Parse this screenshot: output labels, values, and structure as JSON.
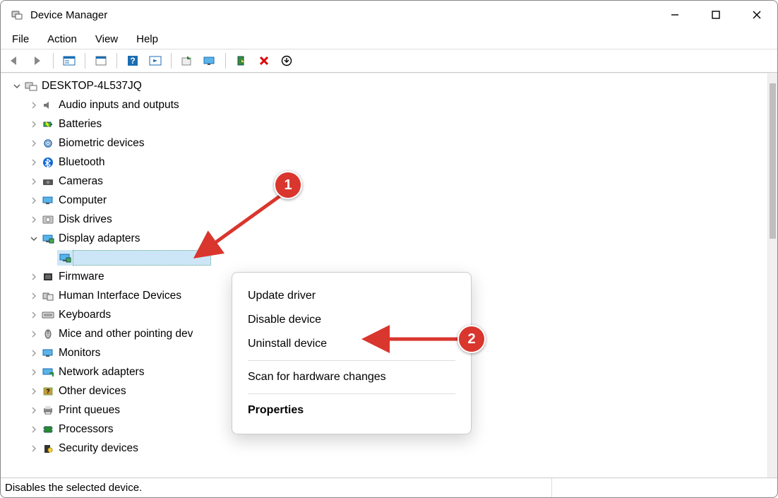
{
  "title": "Device Manager",
  "menubar": [
    "File",
    "Action",
    "View",
    "Help"
  ],
  "root_node": "DESKTOP-4L537JQ",
  "categories": [
    {
      "label": "Audio inputs and outputs",
      "icon": "speaker"
    },
    {
      "label": "Batteries",
      "icon": "battery"
    },
    {
      "label": "Biometric devices",
      "icon": "fingerprint"
    },
    {
      "label": "Bluetooth",
      "icon": "bluetooth"
    },
    {
      "label": "Cameras",
      "icon": "camera"
    },
    {
      "label": "Computer",
      "icon": "computer"
    },
    {
      "label": "Disk drives",
      "icon": "disk"
    },
    {
      "label": "Display adapters",
      "icon": "display",
      "expanded": true,
      "children": [
        {
          "label": "",
          "icon": "display",
          "selected": true
        }
      ]
    },
    {
      "label": "Firmware",
      "icon": "firmware"
    },
    {
      "label": "Human Interface Devices",
      "icon": "hid"
    },
    {
      "label": "Keyboards",
      "icon": "keyboard"
    },
    {
      "label": "Mice and other pointing dev",
      "icon": "mouse"
    },
    {
      "label": "Monitors",
      "icon": "monitor"
    },
    {
      "label": "Network adapters",
      "icon": "network"
    },
    {
      "label": "Other devices",
      "icon": "other"
    },
    {
      "label": "Print queues",
      "icon": "printer"
    },
    {
      "label": "Processors",
      "icon": "cpu"
    },
    {
      "label": "Security devices",
      "icon": "security"
    }
  ],
  "context_menu": {
    "items": [
      {
        "label": "Update driver"
      },
      {
        "label": "Disable device"
      },
      {
        "label": "Uninstall device"
      },
      {
        "sep": true
      },
      {
        "label": "Scan for hardware changes"
      },
      {
        "sep": true
      },
      {
        "label": "Properties",
        "bold": true
      }
    ]
  },
  "status_text": "Disables the selected device.",
  "callouts": {
    "one": "1",
    "two": "2"
  }
}
